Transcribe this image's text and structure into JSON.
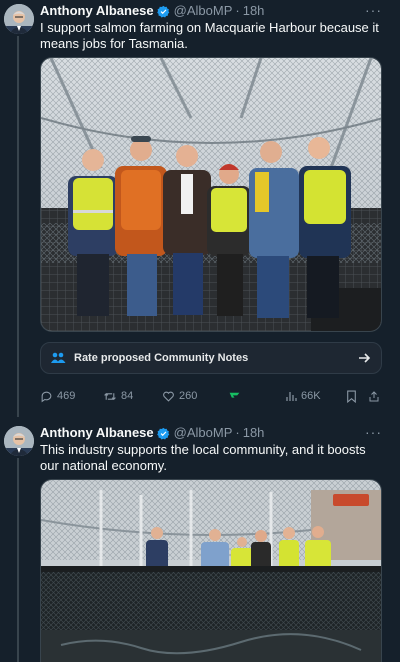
{
  "tweets": [
    {
      "author": "Anthony Albanese",
      "handle": "@AlboMP",
      "dot": "·",
      "time": "18h",
      "more": "···",
      "text": "I support salmon farming on Macquarie Harbour because it means jobs for Tasmania.",
      "community_notes": {
        "label": "Rate proposed Community Notes"
      },
      "actions": {
        "replies": "469",
        "retweets": "84",
        "likes": "260",
        "views": "66K"
      }
    },
    {
      "author": "Anthony Albanese",
      "handle": "@AlboMP",
      "dot": "·",
      "time": "18h",
      "more": "···",
      "text": "This industry supports the local community, and it boosts our national economy."
    }
  ],
  "colors": {
    "background": "#15202b",
    "verified": "#1d9bf0",
    "muted": "#8b98a5",
    "notes_icon": "#1d9bf0",
    "grok": "#17bf63"
  },
  "icons": [
    "verified-badge-icon",
    "more-icon",
    "community-notes-icon",
    "arrow-right-icon",
    "reply-icon",
    "retweet-icon",
    "like-icon",
    "grok-icon",
    "views-icon",
    "bookmark-icon",
    "share-icon"
  ]
}
